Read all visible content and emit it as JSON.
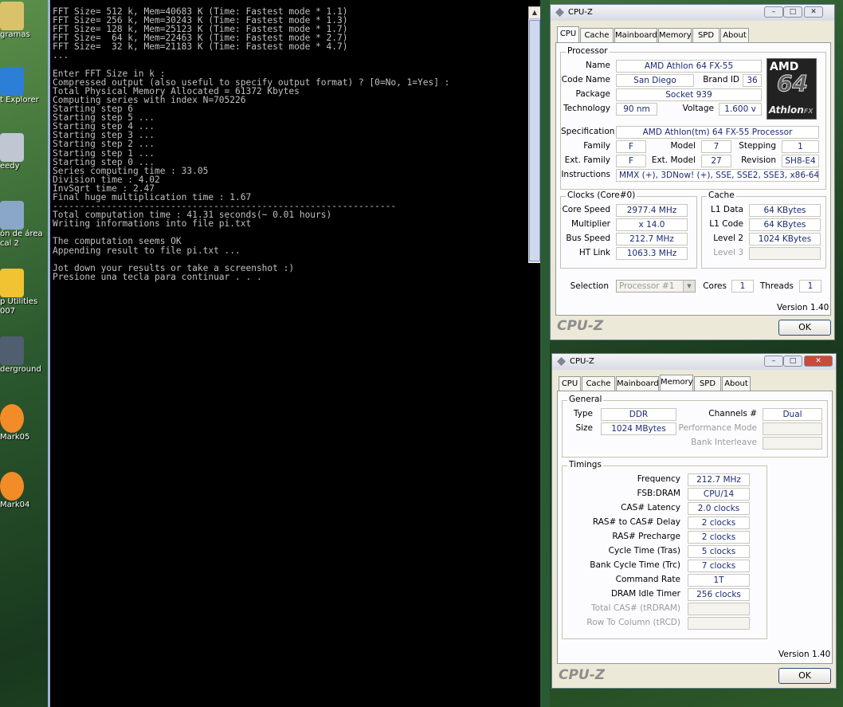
{
  "desktop": {
    "icons": [
      {
        "label": "gramas"
      },
      {
        "label": "t Explorer"
      },
      {
        "label": "eedy"
      },
      {
        "label": "ón de área\ncal 2"
      },
      {
        "label": "p Utilities\n007"
      },
      {
        "label": "derground"
      },
      {
        "label": "Mark05"
      },
      {
        "label": "Mark04"
      }
    ]
  },
  "console": {
    "lines": [
      "FFT Size= 512 k, Mem=40683 K (Time: Fastest mode * 1.1)",
      "FFT Size= 256 k, Mem=30243 K (Time: Fastest mode * 1.3)",
      "FFT Size= 128 k, Mem=25123 K (Time: Fastest mode * 1.7)",
      "FFT Size=  64 k, Mem=22463 K (Time: Fastest mode * 2.7)",
      "FFT Size=  32 k, Mem=21183 K (Time: Fastest mode * 4.7)",
      "...",
      "",
      "Enter FFT Size in k :",
      "Compressed output (also useful to specify output format) ? [0=No, 1=Yes] :",
      "Total Physical Memory Allocated = 61372 Kbytes",
      "Computing series with index N=705226",
      "Starting step 6",
      "Starting step 5 ...",
      "Starting step 4 ...",
      "Starting step 3 ...",
      "Starting step 2 ...",
      "Starting step 1 ...",
      "Starting step 0 ...",
      "Series computing time : 33.05",
      "Division time : 4.02",
      "InvSqrt time : 2.47",
      "Final huge multiplication time : 1.67",
      "----------------------------------------------------------------",
      "Total computation time : 41.31 seconds(~ 0.01 hours)",
      "Writing informations into file pi.txt",
      "",
      "The computation seems OK",
      "Appending result to file pi.txt ...",
      "",
      "Jot down your results or take a screenshot :)",
      "Presione una tecla para continuar . . ."
    ]
  },
  "cpuz1": {
    "title": "CPU-Z",
    "tabs": [
      "CPU",
      "Cache",
      "Mainboard",
      "Memory",
      "SPD",
      "About"
    ],
    "active_tab": "CPU",
    "processor": {
      "group": "Processor",
      "name_label": "Name",
      "name": "AMD Athlon 64 FX-55",
      "codename_label": "Code Name",
      "codename": "San Diego",
      "brandid_label": "Brand ID",
      "brandid": "36",
      "package_label": "Package",
      "package": "Socket 939",
      "technology_label": "Technology",
      "technology": "90 nm",
      "voltage_label": "Voltage",
      "voltage": "1.600 v",
      "spec_label": "Specification",
      "spec": "AMD Athlon(tm) 64 FX-55 Processor",
      "family_label": "Family",
      "family": "F",
      "model_label": "Model",
      "model": "7",
      "stepping_label": "Stepping",
      "stepping": "1",
      "extfamily_label": "Ext. Family",
      "extfamily": "F",
      "extmodel_label": "Ext. Model",
      "extmodel": "27",
      "revision_label": "Revision",
      "revision": "SH8-E4",
      "instructions_label": "Instructions",
      "instructions": "MMX (+), 3DNow! (+), SSE, SSE2, SSE3, x86-64"
    },
    "logo": {
      "line1": "AMD",
      "line2": "64",
      "line3": "Athlon",
      "line3b": "FX"
    },
    "clocks": {
      "group": "Clocks (Core#0)",
      "core_speed_label": "Core Speed",
      "core_speed": "2977.4 MHz",
      "multiplier_label": "Multiplier",
      "multiplier": "x 14.0",
      "bus_speed_label": "Bus Speed",
      "bus_speed": "212.7 MHz",
      "ht_link_label": "HT Link",
      "ht_link": "1063.3 MHz"
    },
    "cache": {
      "group": "Cache",
      "l1d_label": "L1 Data",
      "l1d": "64 KBytes",
      "l1c_label": "L1 Code",
      "l1c": "64 KBytes",
      "l2_label": "Level 2",
      "l2": "1024 KBytes",
      "l3_label": "Level 3",
      "l3": ""
    },
    "selection_label": "Selection",
    "selection": "Processor #1",
    "cores_label": "Cores",
    "cores": "1",
    "threads_label": "Threads",
    "threads": "1",
    "version": "Version 1.40",
    "brand": "CPU-Z",
    "ok": "OK"
  },
  "cpuz2": {
    "title": "CPU-Z",
    "tabs": [
      "CPU",
      "Cache",
      "Mainboard",
      "Memory",
      "SPD",
      "About"
    ],
    "active_tab": "Memory",
    "general": {
      "group": "General",
      "type_label": "Type",
      "type": "DDR",
      "size_label": "Size",
      "size": "1024 MBytes",
      "channels_label": "Channels #",
      "channels": "Dual",
      "perf_label": "Performance Mode",
      "perf": "",
      "bank_label": "Bank Interleave",
      "bank": ""
    },
    "timings": {
      "group": "Timings",
      "rows": [
        {
          "label": "Frequency",
          "value": "212.7 MHz",
          "dim": false
        },
        {
          "label": "FSB:DRAM",
          "value": "CPU/14",
          "dim": false
        },
        {
          "label": "CAS# Latency",
          "value": "2.0 clocks",
          "dim": false
        },
        {
          "label": "RAS# to CAS# Delay",
          "value": "2 clocks",
          "dim": false
        },
        {
          "label": "RAS# Precharge",
          "value": "2 clocks",
          "dim": false
        },
        {
          "label": "Cycle Time (Tras)",
          "value": "5 clocks",
          "dim": false
        },
        {
          "label": "Bank Cycle Time (Trc)",
          "value": "7 clocks",
          "dim": false
        },
        {
          "label": "Command Rate",
          "value": "1T",
          "dim": false
        },
        {
          "label": "DRAM Idle Timer",
          "value": "256 clocks",
          "dim": false
        },
        {
          "label": "Total CAS# (tRDRAM)",
          "value": "",
          "dim": true
        },
        {
          "label": "Row To Column (tRCD)",
          "value": "",
          "dim": true
        }
      ]
    },
    "version": "Version 1.40",
    "brand": "CPU-Z",
    "ok": "OK"
  }
}
